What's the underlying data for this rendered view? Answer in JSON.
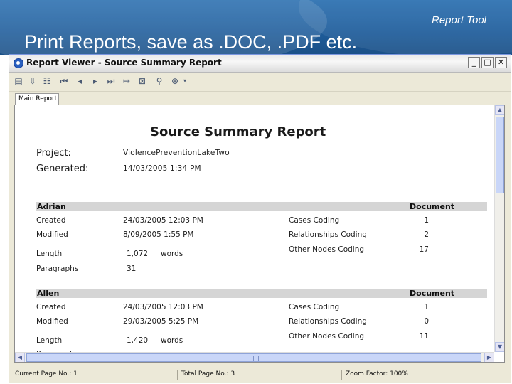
{
  "slide": {
    "title": "Print Reports, save as .DOC, .PDF etc.",
    "tag": "Report Tool"
  },
  "window": {
    "title": "Report Viewer - Source Summary Report",
    "buttons": {
      "minimize": "_",
      "maximize": "□",
      "close": "✕"
    }
  },
  "tabs": [
    "Main Report"
  ],
  "report": {
    "title": "Source Summary Report",
    "project_label": "Project:",
    "project_value": "ViolencePreventionLakeTwo",
    "generated_label": "Generated:",
    "generated_value": "14/03/2005 1:34 PM",
    "document_header": "Document",
    "labels": {
      "created": "Created",
      "modified": "Modified",
      "length": "Length",
      "paragraphs": "Paragraphs",
      "cases": "Cases Coding",
      "relationships": "Relationships Coding",
      "other_nodes": "Other Nodes Coding",
      "words": "words"
    },
    "sources": [
      {
        "name": "Adrian",
        "created": "24/03/2005 12:03 PM",
        "modified": "8/09/2005 1:55 PM",
        "length": "1,072",
        "paragraphs": "31",
        "cases": "1",
        "relationships": "2",
        "other_nodes": "17"
      },
      {
        "name": "Allen",
        "created": "24/03/2005 12:03 PM",
        "modified": "29/03/2005 5:25 PM",
        "length": "1,420",
        "paragraphs": "",
        "cases": "1",
        "relationships": "0",
        "other_nodes": "11"
      }
    ]
  },
  "status": {
    "current_page": "Current Page No.: 1",
    "total_page": "Total Page No.: 3",
    "zoom": "Zoom Factor: 100%"
  }
}
